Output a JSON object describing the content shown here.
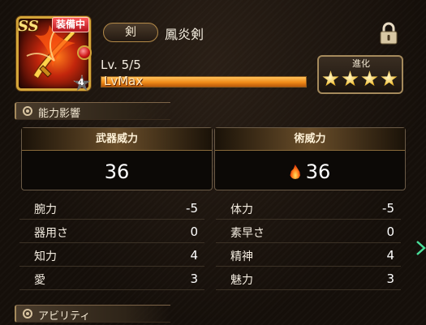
{
  "item": {
    "rank": "SS",
    "equipped_tag": "装備中",
    "category": "剣",
    "name": "鳳炎剣",
    "star_level": "4",
    "level_label": "Lv. 5/5",
    "level_progress": 1.0,
    "lv_max_text": "LvMax",
    "evolution_label": "進化",
    "evolution_stars": 4,
    "locked": true
  },
  "sections": {
    "ability_effects": "能力影響",
    "abilities": "アビリティ"
  },
  "power": {
    "weapon": {
      "label": "武器威力",
      "value": "36"
    },
    "magic": {
      "label": "術威力",
      "value": "36",
      "element": "fire-icon"
    }
  },
  "stats_left": [
    {
      "label": "腕力",
      "value": "-5"
    },
    {
      "label": "器用さ",
      "value": "0"
    },
    {
      "label": "知力",
      "value": "4"
    },
    {
      "label": "愛",
      "value": "3"
    }
  ],
  "stats_right": [
    {
      "label": "体力",
      "value": "-5"
    },
    {
      "label": "素早さ",
      "value": "0"
    },
    {
      "label": "精神",
      "value": "4"
    },
    {
      "label": "魅力",
      "value": "3"
    }
  ],
  "colors": {
    "accent_gold": "#d4a63a",
    "bar_orange": "#f08a18",
    "equipped_red": "#b3141e"
  }
}
